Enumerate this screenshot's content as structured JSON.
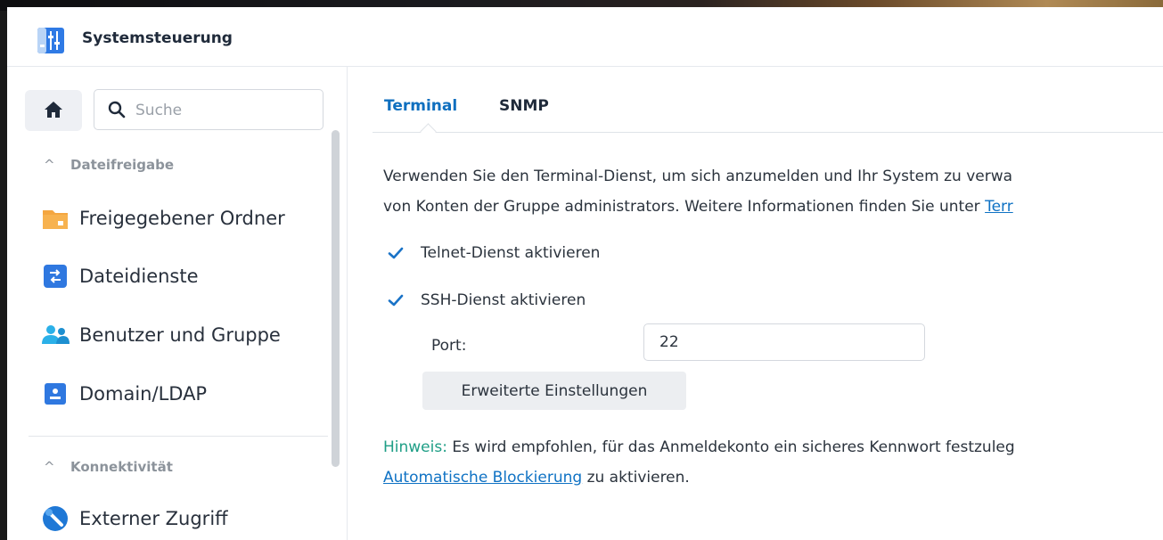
{
  "window": {
    "title": "Systemsteuerung",
    "icon": "control-panel-icon"
  },
  "sidebar": {
    "search_placeholder": "Suche",
    "sections": [
      {
        "chevron": "^",
        "label": "Dateifreigabe"
      },
      {
        "chevron": "^",
        "label": "Konnektivität"
      }
    ],
    "items": [
      {
        "label": "Freigegebener Ordner",
        "icon": "shared-folder-icon"
      },
      {
        "label": "Dateidienste",
        "icon": "file-services-icon"
      },
      {
        "label": "Benutzer und Gruppe",
        "icon": "user-group-icon"
      },
      {
        "label": "Domain/LDAP",
        "icon": "domain-ldap-icon"
      },
      {
        "label": "Externer Zugriff",
        "icon": "external-access-icon"
      }
    ]
  },
  "main": {
    "tabs": [
      {
        "label": "Terminal",
        "active": true
      },
      {
        "label": "SNMP",
        "active": false
      }
    ],
    "description": {
      "line1": "Verwenden Sie den Terminal-Dienst, um sich anzumelden und Ihr System zu verwa",
      "line2_text": "von Konten der Gruppe administrators. Weitere Informationen finden Sie unter ",
      "line2_link": "Terr"
    },
    "telnet": {
      "label": "Telnet-Dienst aktivieren",
      "checked": true
    },
    "ssh": {
      "label": "SSH-Dienst aktivieren",
      "checked": true
    },
    "port": {
      "label": "Port:",
      "value": "22"
    },
    "advanced_button": "Erweiterte Einstellungen",
    "hint": {
      "label": "Hinweis:",
      "text": " Es wird empfohlen, für das Anmeldekonto ein sicheres Kennwort festzuleg",
      "link": "Automatische Blockierung",
      "text2": " zu aktivieren."
    }
  },
  "colors": {
    "accent": "#0f6fbf",
    "hint": "#1e9e86",
    "checkbox": "#1a73c7"
  }
}
